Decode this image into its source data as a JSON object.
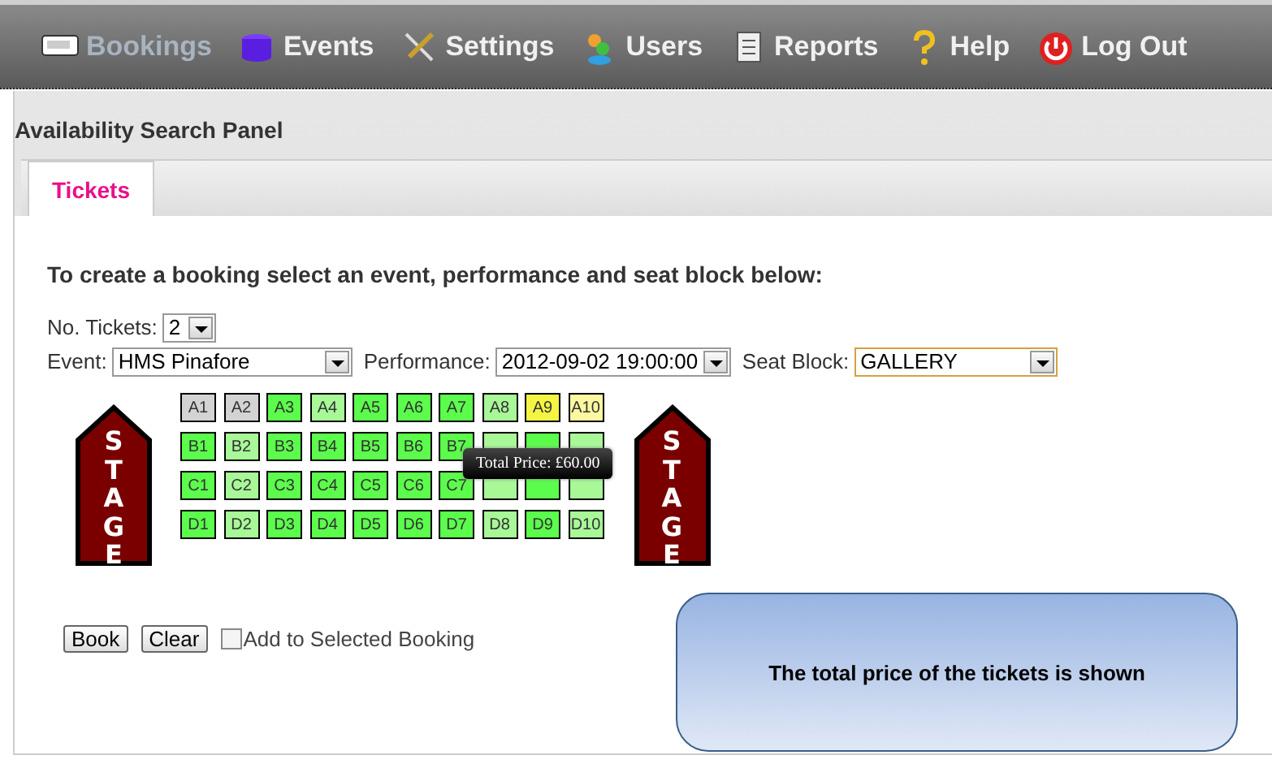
{
  "nav": [
    {
      "label": "Bookings",
      "selected": true
    },
    {
      "label": "Events",
      "selected": false
    },
    {
      "label": "Settings",
      "selected": false
    },
    {
      "label": "Users",
      "selected": false
    },
    {
      "label": "Reports",
      "selected": false
    },
    {
      "label": "Help",
      "selected": false
    },
    {
      "label": "Log Out",
      "selected": false
    }
  ],
  "panel": {
    "title": "Availability Search Panel"
  },
  "tabs": [
    {
      "label": "Tickets",
      "selected": true
    }
  ],
  "instructions": "To create a booking select an event, performance and seat block below:",
  "form": {
    "tickets": {
      "label": "No. Tickets:",
      "value": "2"
    },
    "event": {
      "label": "Event:",
      "value": "HMS Pinafore"
    },
    "performance": {
      "label": "Performance:",
      "value": "2012-09-02 19:00:00"
    },
    "seat_block": {
      "label": "Seat Block:",
      "value": "GALLERY"
    }
  },
  "stage_signs": [
    "STAGE",
    "STAGE"
  ],
  "seats": [
    [
      {
        "label": "A1",
        "kind": "booked"
      },
      {
        "label": "A2",
        "kind": "booked"
      },
      {
        "label": "A3",
        "kind": "available"
      },
      {
        "label": "A4",
        "kind": "light"
      },
      {
        "label": "A5",
        "kind": "available"
      },
      {
        "label": "A6",
        "kind": "available"
      },
      {
        "label": "A7",
        "kind": "available"
      },
      {
        "label": "A8",
        "kind": "light"
      },
      {
        "label": "A9",
        "kind": "selected"
      },
      {
        "label": "A10",
        "kind": "hover"
      }
    ],
    [
      {
        "label": "B1",
        "kind": "available"
      },
      {
        "label": "B2",
        "kind": "light"
      },
      {
        "label": "B3",
        "kind": "available"
      },
      {
        "label": "B4",
        "kind": "available"
      },
      {
        "label": "B5",
        "kind": "available"
      },
      {
        "label": "B6",
        "kind": "available"
      },
      {
        "label": "B7",
        "kind": "available"
      },
      {
        "kind": "light"
      },
      {
        "kind": "available"
      },
      {
        "kind": "light"
      }
    ],
    [
      {
        "label": "C1",
        "kind": "available"
      },
      {
        "label": "C2",
        "kind": "light"
      },
      {
        "label": "C3",
        "kind": "available"
      },
      {
        "label": "C4",
        "kind": "available"
      },
      {
        "label": "C5",
        "kind": "available"
      },
      {
        "label": "C6",
        "kind": "available"
      },
      {
        "label": "C7",
        "kind": "available"
      },
      {
        "kind": "light"
      },
      {
        "kind": "available"
      },
      {
        "kind": "light"
      }
    ],
    [
      {
        "label": "D1",
        "kind": "available"
      },
      {
        "label": "D2",
        "kind": "light"
      },
      {
        "label": "D3",
        "kind": "available"
      },
      {
        "label": "D4",
        "kind": "available"
      },
      {
        "label": "D5",
        "kind": "available"
      },
      {
        "label": "D6",
        "kind": "available"
      },
      {
        "label": "D7",
        "kind": "available"
      },
      {
        "label": "D8",
        "kind": "light"
      },
      {
        "label": "D9",
        "kind": "available"
      },
      {
        "label": "D10",
        "kind": "light"
      }
    ]
  ],
  "tooltip": "Total Price: £60.00",
  "buttons": [
    "Book",
    "Clear"
  ],
  "add_to_selected": {
    "label": "Add to Selected Booking",
    "checked": false
  },
  "callout": "The total price of the tickets is shown"
}
